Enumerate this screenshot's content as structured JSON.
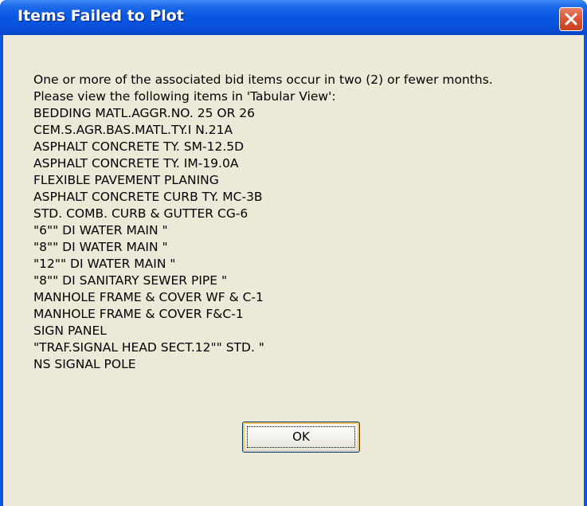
{
  "window": {
    "title": "Items Failed to Plot",
    "close_icon": "close-x-icon"
  },
  "message": {
    "lines": [
      "One or more of the associated bid items occur in two (2) or fewer months.",
      "Please view the following items in 'Tabular View':"
    ],
    "items": [
      "BEDDING MATL.AGGR.NO. 25 OR 26",
      "CEM.S.AGR.BAS.MATL.TY.I N.21A",
      "ASPHALT CONCRETE TY. SM-12.5D",
      "ASPHALT CONCRETE TY. IM-19.0A",
      "FLEXIBLE PAVEMENT PLANING",
      "ASPHALT CONCRETE CURB TY. MC-3B",
      "STD. COMB. CURB & GUTTER CG-6",
      "\"6\"\" DI WATER MAIN \"",
      "\"8\"\" DI WATER MAIN \"",
      "\"12\"\" DI WATER MAIN \"",
      "\"8\"\" DI SANITARY SEWER PIPE \"",
      "MANHOLE FRAME & COVER WF & C-1",
      "MANHOLE FRAME & COVER F&C-1",
      "SIGN PANEL",
      "\"TRAF.SIGNAL HEAD SECT.12\"\" STD. \"",
      "NS SIGNAL POLE"
    ]
  },
  "buttons": {
    "ok_label": "OK"
  },
  "colors": {
    "titlebar": "#0a55e0",
    "client_bg": "#ece9d8",
    "close_button": "#dc5a3a"
  }
}
